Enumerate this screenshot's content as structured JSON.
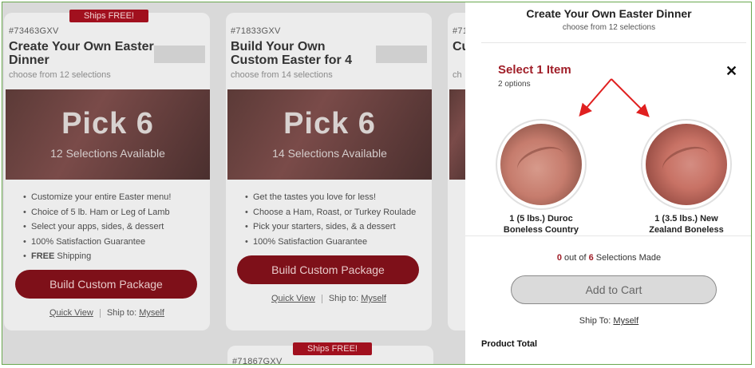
{
  "cards": [
    {
      "badge": "Ships FREE!",
      "sku": "#73463GXV",
      "title": "Create Your Own Easter Dinner",
      "subtitle": "choose from 12 selections",
      "hero_title": "Pick 6",
      "hero_sub": "12 Selections Available",
      "bullets": [
        "Customize your entire Easter menu!",
        "Choice of 5 lb. Ham or Leg of Lamb",
        "Select your apps, sides, & dessert",
        "100% Satisfaction Guarantee"
      ],
      "bullet_bold": "FREE",
      "bullet_last_rest": " Shipping",
      "button": "Build Custom Package",
      "quick_view": "Quick View",
      "ship_to_label": "Ship to:",
      "ship_to_value": "Myself"
    },
    {
      "sku": "#71833GXV",
      "title": "Build Your Own Custom Easter for 4",
      "subtitle": "choose from 14 selections",
      "hero_title": "Pick 6",
      "hero_sub": "14 Selections Available",
      "bullets": [
        "Get the tastes you love for less!",
        "Choose a Ham, Roast, or Turkey Roulade",
        "Pick your starters, sides, & a dessert",
        "100% Satisfaction Guarantee"
      ],
      "button": "Build Custom Package",
      "quick_view": "Quick View",
      "ship_to_label": "Ship to:",
      "ship_to_value": "Myself"
    },
    {
      "sku": "#71",
      "title": "Cu",
      "subtitle": "ch"
    },
    {
      "badge": "Ships FREE!",
      "sku": "#71867GXV"
    }
  ],
  "panel": {
    "title": "Create Your Own Easter Dinner",
    "subtitle": "choose from 12 selections",
    "select_title": "Select 1 Item",
    "select_sub": "2 options",
    "close": "✕",
    "items": [
      {
        "name_line1": "1 (5 lbs.) Duroc",
        "name_line2": "Boneless Country"
      },
      {
        "name_line1": "1 (3.5 lbs.) New",
        "name_line2": "Zealand Boneless"
      }
    ],
    "count_made": "0",
    "count_out_of": " out of ",
    "count_total": "6",
    "count_suffix": " Selections Made",
    "add_to_cart": "Add to Cart",
    "ship_to_label": "Ship To: ",
    "ship_to_value": "Myself",
    "product_total": "Product Total"
  },
  "colors": {
    "brand_red": "#a01e28",
    "button_dark_red": "#7e1019",
    "annotation_arrow": "#e02020"
  }
}
